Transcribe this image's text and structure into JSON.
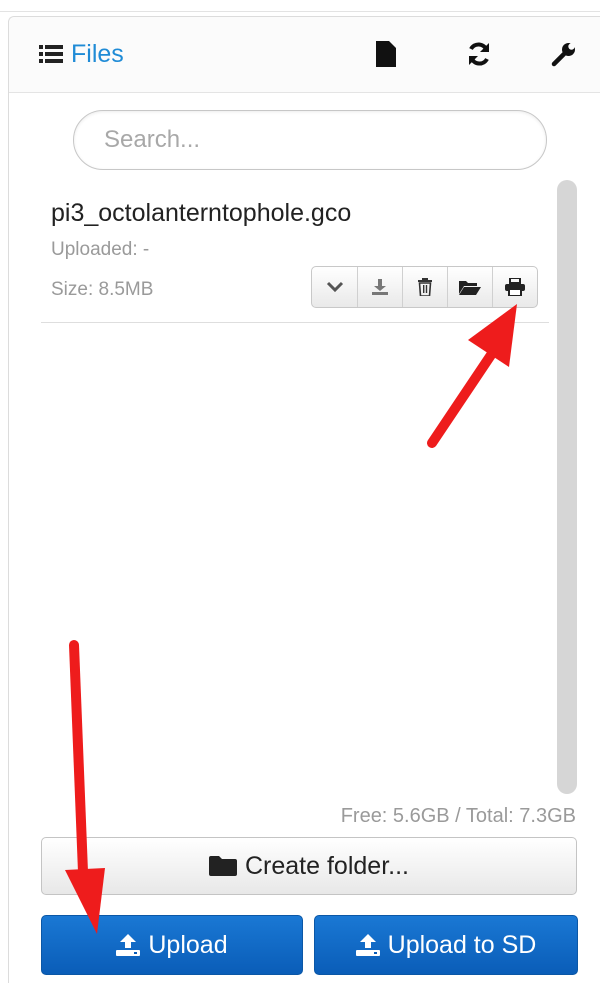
{
  "header": {
    "title": "Files",
    "title_icon": "list-icon",
    "actions": [
      {
        "icon": "file-icon"
      },
      {
        "icon": "refresh-icon"
      },
      {
        "icon": "wrench-icon"
      }
    ]
  },
  "search": {
    "placeholder": "Search...",
    "value": ""
  },
  "files": [
    {
      "name": "pi3_octolanterntophole.gco",
      "uploaded": "Uploaded: -",
      "size": "Size: 8.5MB",
      "actions": [
        "chevron-down-icon",
        "download-icon",
        "trash-icon",
        "folder-open-icon",
        "print-icon"
      ]
    }
  ],
  "storage": {
    "free_total": "Free: 5.6GB / Total: 7.3GB"
  },
  "buttons": {
    "create_folder": "Create folder...",
    "upload": "Upload",
    "upload_sd": "Upload to SD"
  },
  "colors": {
    "link_blue": "#1f8bd6",
    "primary_button": "#0a5db8",
    "annotation_arrow": "#ee1c1c"
  }
}
